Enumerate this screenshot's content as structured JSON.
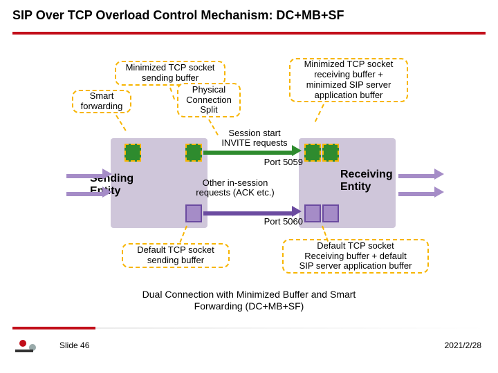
{
  "title": "SIP Over TCP Overload Control Mechanism: DC+MB+SF",
  "callouts": {
    "min_send": "Minimized TCP socket\nsending buffer",
    "smart_fwd": "Smart\nforwarding",
    "phys_split": "Physical\nConnection\nSplit",
    "min_recv": "Minimized TCP socket\nreceiving buffer +\nminimized SIP server\napplication buffer",
    "def_send": "Default TCP socket\nsending buffer",
    "def_recv": "Default TCP socket\nReceiving buffer + default\nSIP server application buffer"
  },
  "labels": {
    "sending": "Sending\nEntity",
    "receiving": "Receiving\nEntity",
    "session_start": "Session start\nINVITE requests",
    "port_top": "Port 5059",
    "in_session": "Other in-session\nrequests (ACK etc.)",
    "port_bot": "Port 5060"
  },
  "caption": "Dual Connection with Minimized Buffer and Smart\nForwarding (DC+MB+SF)",
  "footer": {
    "slide": "Slide 46",
    "date": "2021/2/28"
  }
}
